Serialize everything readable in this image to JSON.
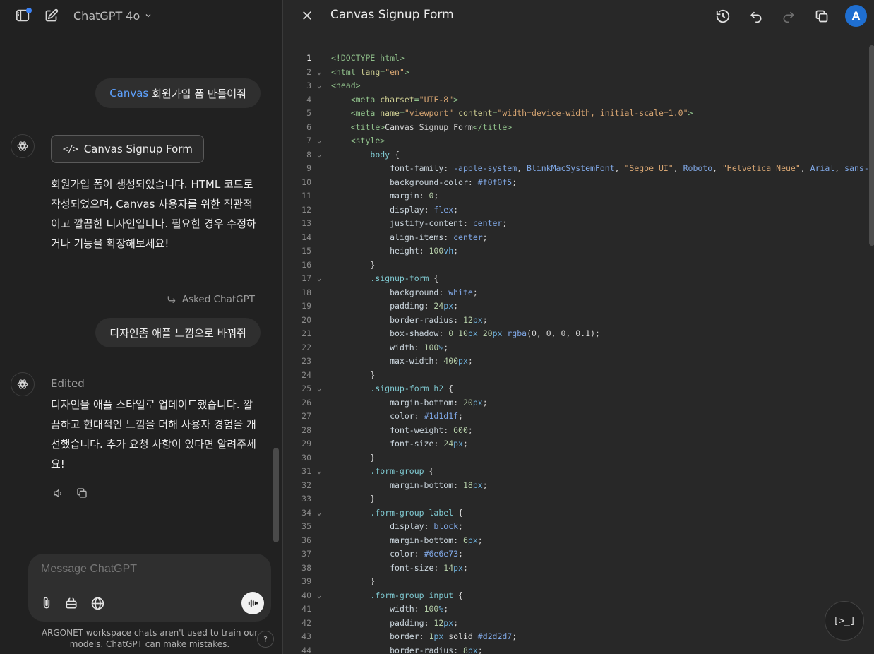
{
  "chat": {
    "model_name": "ChatGPT 4o",
    "user_msg_1": {
      "highlight": "Canvas",
      "text": "회원가입 폼 만들어줘"
    },
    "canvas_card_label": "Canvas Signup Form",
    "assistant_msg_1": "회원가입 폼이 생성되었습니다. HTML 코드로 작성되었으며, Canvas 사용자를 위한 직관적이고 깔끔한 디자인입니다. 필요한 경우 수정하거나 기능을 확장해보세요!",
    "asked_label": "Asked ChatGPT",
    "user_msg_2": "디자인좀 애플 느낌으로 바꿔줘",
    "edited_label": "Edited",
    "assistant_msg_2": "디자인을 애플 스타일로 업데이트했습니다. 깔끔하고 현대적인 느낌을 더해 사용자 경험을 개선했습니다. 추가 요청 사항이 있다면 알려주세요!",
    "composer_placeholder": "Message ChatGPT",
    "disclaimer": "ARGONET workspace chats aren't used to train our models. ChatGPT can make mistakes.",
    "help_label": "?"
  },
  "canvas": {
    "title": "Canvas Signup Form",
    "user_initial": "A",
    "run_label": "[>_]",
    "active_line": 1,
    "lines": [
      {
        "n": 1,
        "fold": false,
        "tokens": [
          [
            "doc",
            "<!DOCTYPE html>"
          ]
        ]
      },
      {
        "n": 2,
        "fold": true,
        "tokens": [
          [
            "tag",
            "<html "
          ],
          [
            "attr",
            "lang"
          ],
          [
            "tag",
            "="
          ],
          [
            "str",
            "\"en\""
          ],
          [
            "tag",
            ">"
          ]
        ]
      },
      {
        "n": 3,
        "fold": true,
        "tokens": [
          [
            "tag",
            "<head>"
          ]
        ]
      },
      {
        "n": 4,
        "fold": false,
        "tokens": [
          [
            "sp",
            "    "
          ],
          [
            "tag",
            "<meta "
          ],
          [
            "attr",
            "charset"
          ],
          [
            "tag",
            "="
          ],
          [
            "str",
            "\"UTF-8\""
          ],
          [
            "tag",
            ">"
          ]
        ]
      },
      {
        "n": 5,
        "fold": false,
        "tokens": [
          [
            "sp",
            "    "
          ],
          [
            "tag",
            "<meta "
          ],
          [
            "attr",
            "name"
          ],
          [
            "tag",
            "="
          ],
          [
            "str",
            "\"viewport\""
          ],
          [
            "tag",
            " "
          ],
          [
            "attr",
            "content"
          ],
          [
            "tag",
            "="
          ],
          [
            "str",
            "\"width=device-width, initial-scale=1.0\""
          ],
          [
            "tag",
            ">"
          ]
        ]
      },
      {
        "n": 6,
        "fold": false,
        "tokens": [
          [
            "sp",
            "    "
          ],
          [
            "tag",
            "<title>"
          ],
          [
            "val",
            "Canvas Signup Form"
          ],
          [
            "tag",
            "</title>"
          ]
        ]
      },
      {
        "n": 7,
        "fold": true,
        "tokens": [
          [
            "sp",
            "    "
          ],
          [
            "tag",
            "<style>"
          ]
        ]
      },
      {
        "n": 8,
        "fold": true,
        "tokens": [
          [
            "sp",
            "        "
          ],
          [
            "sel",
            "body"
          ],
          [
            "val",
            " {"
          ]
        ]
      },
      {
        "n": 9,
        "fold": false,
        "tokens": [
          [
            "sp",
            "            "
          ],
          [
            "prop",
            "font-family"
          ],
          [
            "val",
            ": "
          ],
          [
            "kw",
            "-apple-system"
          ],
          [
            "val",
            ", "
          ],
          [
            "kw",
            "BlinkMacSystemFont"
          ],
          [
            "val",
            ", "
          ],
          [
            "str",
            "\"Segoe UI\""
          ],
          [
            "val",
            ", "
          ],
          [
            "kw",
            "Roboto"
          ],
          [
            "val",
            ", "
          ],
          [
            "str",
            "\"Helvetica Neue\""
          ],
          [
            "val",
            ", "
          ],
          [
            "kw",
            "Arial"
          ],
          [
            "val",
            ", "
          ],
          [
            "kw",
            "sans-serif"
          ],
          [
            "val",
            ";"
          ]
        ]
      },
      {
        "n": 10,
        "fold": false,
        "tokens": [
          [
            "sp",
            "            "
          ],
          [
            "prop",
            "background-color"
          ],
          [
            "val",
            ": "
          ],
          [
            "kw",
            "#f0f0f5"
          ],
          [
            "val",
            ";"
          ]
        ]
      },
      {
        "n": 11,
        "fold": false,
        "tokens": [
          [
            "sp",
            "            "
          ],
          [
            "prop",
            "margin"
          ],
          [
            "val",
            ": "
          ],
          [
            "num",
            "0"
          ],
          [
            "val",
            ";"
          ]
        ]
      },
      {
        "n": 12,
        "fold": false,
        "tokens": [
          [
            "sp",
            "            "
          ],
          [
            "prop",
            "display"
          ],
          [
            "val",
            ": "
          ],
          [
            "kw",
            "flex"
          ],
          [
            "val",
            ";"
          ]
        ]
      },
      {
        "n": 13,
        "fold": false,
        "tokens": [
          [
            "sp",
            "            "
          ],
          [
            "prop",
            "justify-content"
          ],
          [
            "val",
            ": "
          ],
          [
            "kw",
            "center"
          ],
          [
            "val",
            ";"
          ]
        ]
      },
      {
        "n": 14,
        "fold": false,
        "tokens": [
          [
            "sp",
            "            "
          ],
          [
            "prop",
            "align-items"
          ],
          [
            "val",
            ": "
          ],
          [
            "kw",
            "center"
          ],
          [
            "val",
            ";"
          ]
        ]
      },
      {
        "n": 15,
        "fold": false,
        "tokens": [
          [
            "sp",
            "            "
          ],
          [
            "prop",
            "height"
          ],
          [
            "val",
            ": "
          ],
          [
            "num",
            "100"
          ],
          [
            "unit",
            "vh"
          ],
          [
            "val",
            ";"
          ]
        ]
      },
      {
        "n": 16,
        "fold": false,
        "tokens": [
          [
            "sp",
            "        "
          ],
          [
            "val",
            "}"
          ]
        ]
      },
      {
        "n": 17,
        "fold": true,
        "tokens": [
          [
            "sp",
            "        "
          ],
          [
            "sel",
            ".signup-form"
          ],
          [
            "val",
            " {"
          ]
        ]
      },
      {
        "n": 18,
        "fold": false,
        "tokens": [
          [
            "sp",
            "            "
          ],
          [
            "prop",
            "background"
          ],
          [
            "val",
            ": "
          ],
          [
            "kw",
            "white"
          ],
          [
            "val",
            ";"
          ]
        ]
      },
      {
        "n": 19,
        "fold": false,
        "tokens": [
          [
            "sp",
            "            "
          ],
          [
            "prop",
            "padding"
          ],
          [
            "val",
            ": "
          ],
          [
            "num",
            "24"
          ],
          [
            "unit",
            "px"
          ],
          [
            "val",
            ";"
          ]
        ]
      },
      {
        "n": 20,
        "fold": false,
        "tokens": [
          [
            "sp",
            "            "
          ],
          [
            "prop",
            "border-radius"
          ],
          [
            "val",
            ": "
          ],
          [
            "num",
            "12"
          ],
          [
            "unit",
            "px"
          ],
          [
            "val",
            ";"
          ]
        ]
      },
      {
        "n": 21,
        "fold": false,
        "tokens": [
          [
            "sp",
            "            "
          ],
          [
            "prop",
            "box-shadow"
          ],
          [
            "val",
            ": "
          ],
          [
            "num",
            "0 10"
          ],
          [
            "unit",
            "px"
          ],
          [
            "val",
            " "
          ],
          [
            "num",
            "20"
          ],
          [
            "unit",
            "px"
          ],
          [
            "val",
            " "
          ],
          [
            "kw",
            "rgba"
          ],
          [
            "val",
            "(0, 0, 0, 0.1);"
          ]
        ]
      },
      {
        "n": 22,
        "fold": false,
        "tokens": [
          [
            "sp",
            "            "
          ],
          [
            "prop",
            "width"
          ],
          [
            "val",
            ": "
          ],
          [
            "num",
            "100"
          ],
          [
            "unit",
            "%"
          ],
          [
            "val",
            ";"
          ]
        ]
      },
      {
        "n": 23,
        "fold": false,
        "tokens": [
          [
            "sp",
            "            "
          ],
          [
            "prop",
            "max-width"
          ],
          [
            "val",
            ": "
          ],
          [
            "num",
            "400"
          ],
          [
            "unit",
            "px"
          ],
          [
            "val",
            ";"
          ]
        ]
      },
      {
        "n": 24,
        "fold": false,
        "tokens": [
          [
            "sp",
            "        "
          ],
          [
            "val",
            "}"
          ]
        ]
      },
      {
        "n": 25,
        "fold": true,
        "tokens": [
          [
            "sp",
            "        "
          ],
          [
            "sel",
            ".signup-form h2"
          ],
          [
            "val",
            " {"
          ]
        ]
      },
      {
        "n": 26,
        "fold": false,
        "tokens": [
          [
            "sp",
            "            "
          ],
          [
            "prop",
            "margin-bottom"
          ],
          [
            "val",
            ": "
          ],
          [
            "num",
            "20"
          ],
          [
            "unit",
            "px"
          ],
          [
            "val",
            ";"
          ]
        ]
      },
      {
        "n": 27,
        "fold": false,
        "tokens": [
          [
            "sp",
            "            "
          ],
          [
            "prop",
            "color"
          ],
          [
            "val",
            ": "
          ],
          [
            "kw",
            "#1d1d1f"
          ],
          [
            "val",
            ";"
          ]
        ]
      },
      {
        "n": 28,
        "fold": false,
        "tokens": [
          [
            "sp",
            "            "
          ],
          [
            "prop",
            "font-weight"
          ],
          [
            "val",
            ": "
          ],
          [
            "num",
            "600"
          ],
          [
            "val",
            ";"
          ]
        ]
      },
      {
        "n": 29,
        "fold": false,
        "tokens": [
          [
            "sp",
            "            "
          ],
          [
            "prop",
            "font-size"
          ],
          [
            "val",
            ": "
          ],
          [
            "num",
            "24"
          ],
          [
            "unit",
            "px"
          ],
          [
            "val",
            ";"
          ]
        ]
      },
      {
        "n": 30,
        "fold": false,
        "tokens": [
          [
            "sp",
            "        "
          ],
          [
            "val",
            "}"
          ]
        ]
      },
      {
        "n": 31,
        "fold": true,
        "tokens": [
          [
            "sp",
            "        "
          ],
          [
            "sel",
            ".form-group"
          ],
          [
            "val",
            " {"
          ]
        ]
      },
      {
        "n": 32,
        "fold": false,
        "tokens": [
          [
            "sp",
            "            "
          ],
          [
            "prop",
            "margin-bottom"
          ],
          [
            "val",
            ": "
          ],
          [
            "num",
            "18"
          ],
          [
            "unit",
            "px"
          ],
          [
            "val",
            ";"
          ]
        ]
      },
      {
        "n": 33,
        "fold": false,
        "tokens": [
          [
            "sp",
            "        "
          ],
          [
            "val",
            "}"
          ]
        ]
      },
      {
        "n": 34,
        "fold": true,
        "tokens": [
          [
            "sp",
            "        "
          ],
          [
            "sel",
            ".form-group label"
          ],
          [
            "val",
            " {"
          ]
        ]
      },
      {
        "n": 35,
        "fold": false,
        "tokens": [
          [
            "sp",
            "            "
          ],
          [
            "prop",
            "display"
          ],
          [
            "val",
            ": "
          ],
          [
            "kw",
            "block"
          ],
          [
            "val",
            ";"
          ]
        ]
      },
      {
        "n": 36,
        "fold": false,
        "tokens": [
          [
            "sp",
            "            "
          ],
          [
            "prop",
            "margin-bottom"
          ],
          [
            "val",
            ": "
          ],
          [
            "num",
            "6"
          ],
          [
            "unit",
            "px"
          ],
          [
            "val",
            ";"
          ]
        ]
      },
      {
        "n": 37,
        "fold": false,
        "tokens": [
          [
            "sp",
            "            "
          ],
          [
            "prop",
            "color"
          ],
          [
            "val",
            ": "
          ],
          [
            "kw",
            "#6e6e73"
          ],
          [
            "val",
            ";"
          ]
        ]
      },
      {
        "n": 38,
        "fold": false,
        "tokens": [
          [
            "sp",
            "            "
          ],
          [
            "prop",
            "font-size"
          ],
          [
            "val",
            ": "
          ],
          [
            "num",
            "14"
          ],
          [
            "unit",
            "px"
          ],
          [
            "val",
            ";"
          ]
        ]
      },
      {
        "n": 39,
        "fold": false,
        "tokens": [
          [
            "sp",
            "        "
          ],
          [
            "val",
            "}"
          ]
        ]
      },
      {
        "n": 40,
        "fold": true,
        "tokens": [
          [
            "sp",
            "        "
          ],
          [
            "sel",
            ".form-group input"
          ],
          [
            "val",
            " {"
          ]
        ]
      },
      {
        "n": 41,
        "fold": false,
        "tokens": [
          [
            "sp",
            "            "
          ],
          [
            "prop",
            "width"
          ],
          [
            "val",
            ": "
          ],
          [
            "num",
            "100"
          ],
          [
            "unit",
            "%"
          ],
          [
            "val",
            ";"
          ]
        ]
      },
      {
        "n": 42,
        "fold": false,
        "tokens": [
          [
            "sp",
            "            "
          ],
          [
            "prop",
            "padding"
          ],
          [
            "val",
            ": "
          ],
          [
            "num",
            "12"
          ],
          [
            "unit",
            "px"
          ],
          [
            "val",
            ";"
          ]
        ]
      },
      {
        "n": 43,
        "fold": false,
        "tokens": [
          [
            "sp",
            "            "
          ],
          [
            "prop",
            "border"
          ],
          [
            "val",
            ": "
          ],
          [
            "num",
            "1"
          ],
          [
            "unit",
            "px"
          ],
          [
            "val",
            " solid "
          ],
          [
            "kw",
            "#d2d2d7"
          ],
          [
            "val",
            ";"
          ]
        ]
      },
      {
        "n": 44,
        "fold": false,
        "tokens": [
          [
            "sp",
            "            "
          ],
          [
            "prop",
            "border-radius"
          ],
          [
            "val",
            ": "
          ],
          [
            "num",
            "8"
          ],
          [
            "unit",
            "px"
          ],
          [
            "val",
            ";"
          ]
        ]
      }
    ]
  }
}
